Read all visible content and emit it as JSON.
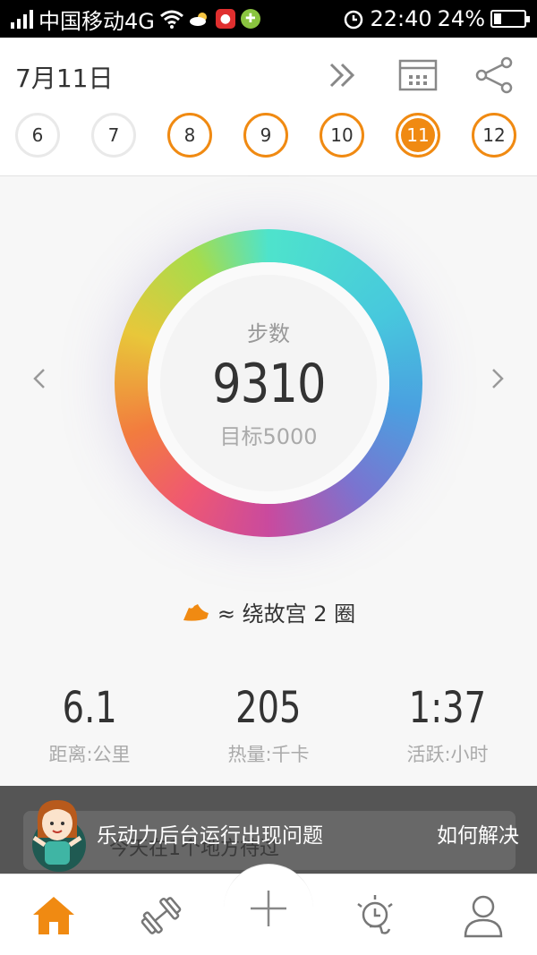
{
  "status_bar": {
    "carrier": "中国移动4G",
    "clock": "22:40",
    "battery": "24%"
  },
  "header": {
    "date": "7月11日",
    "days": [
      {
        "label": "6",
        "state": "partial"
      },
      {
        "label": "7",
        "state": "partial"
      },
      {
        "label": "8",
        "state": "done"
      },
      {
        "label": "9",
        "state": "done"
      },
      {
        "label": "10",
        "state": "done"
      },
      {
        "label": "11",
        "state": "active"
      },
      {
        "label": "12",
        "state": "done"
      }
    ]
  },
  "steps": {
    "label": "步数",
    "value": "9310",
    "goal": "目标5000"
  },
  "compare": {
    "text": "≈ 绕故宫 2 圈"
  },
  "stats": [
    {
      "value": "6.1",
      "label": "距离:公里"
    },
    {
      "value": "205",
      "label": "热量:千卡"
    },
    {
      "value": "1:37",
      "label": "活跃:小时"
    }
  ],
  "banner": {
    "message": "乐动力后台运行出现问题",
    "action": "如何解决",
    "underlying_text": "今天在1个地方待过"
  },
  "colors": {
    "accent": "#f08a12",
    "banner_bg": "#555555"
  },
  "icons": [
    "fast-forward-icon",
    "calendar-icon",
    "share-icon",
    "home-icon",
    "dumbbell-icon",
    "plus-icon",
    "lightbulb-icon",
    "person-icon",
    "shoe-icon"
  ]
}
